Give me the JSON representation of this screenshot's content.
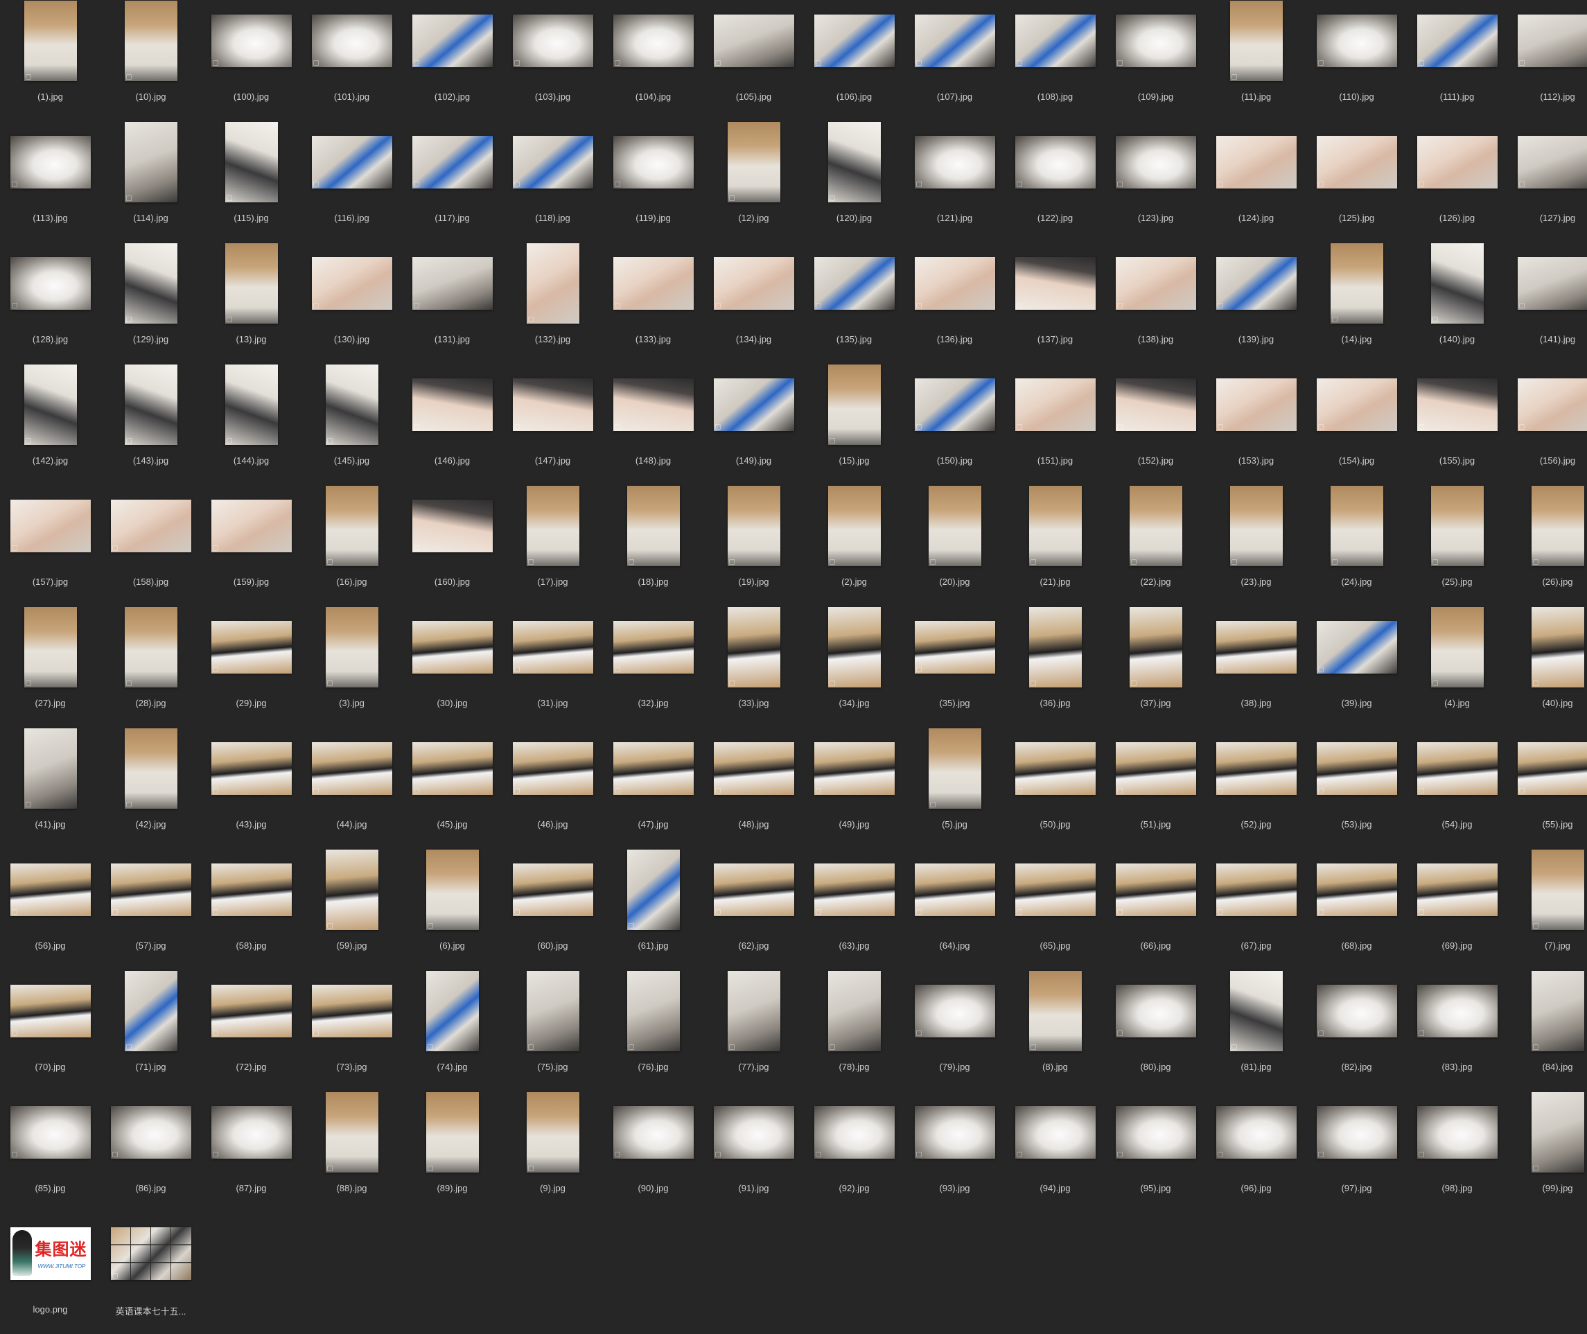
{
  "files": [
    {
      "name": "(1).jpg",
      "o": "p",
      "s": "room"
    },
    {
      "name": "(10).jpg",
      "o": "p",
      "s": "room"
    },
    {
      "name": "(100).jpg",
      "o": "l",
      "s": "sock"
    },
    {
      "name": "(101).jpg",
      "o": "l",
      "s": "sock"
    },
    {
      "name": "(102).jpg",
      "o": "l",
      "s": "blue"
    },
    {
      "name": "(103).jpg",
      "o": "l",
      "s": "sock"
    },
    {
      "name": "(104).jpg",
      "o": "l",
      "s": "sock"
    },
    {
      "name": "(105).jpg",
      "o": "l",
      "s": "sofa"
    },
    {
      "name": "(106).jpg",
      "o": "l",
      "s": "blue"
    },
    {
      "name": "(107).jpg",
      "o": "l",
      "s": "blue"
    },
    {
      "name": "(108).jpg",
      "o": "l",
      "s": "blue"
    },
    {
      "name": "(109).jpg",
      "o": "l",
      "s": "sock"
    },
    {
      "name": "(11).jpg",
      "o": "p",
      "s": "room"
    },
    {
      "name": "(110).jpg",
      "o": "l",
      "s": "sock"
    },
    {
      "name": "(111).jpg",
      "o": "l",
      "s": "blue"
    },
    {
      "name": "(112).jpg",
      "o": "l",
      "s": "sofa"
    },
    {
      "name": "(113).jpg",
      "o": "l",
      "s": "sock"
    },
    {
      "name": "(114).jpg",
      "o": "p",
      "s": "sofa"
    },
    {
      "name": "(115).jpg",
      "o": "p",
      "s": "feet"
    },
    {
      "name": "(116).jpg",
      "o": "l",
      "s": "blue"
    },
    {
      "name": "(117).jpg",
      "o": "l",
      "s": "blue"
    },
    {
      "name": "(118).jpg",
      "o": "l",
      "s": "blue"
    },
    {
      "name": "(119).jpg",
      "o": "l",
      "s": "sock"
    },
    {
      "name": "(12).jpg",
      "o": "p",
      "s": "room"
    },
    {
      "name": "(120).jpg",
      "o": "p",
      "s": "feet"
    },
    {
      "name": "(121).jpg",
      "o": "l",
      "s": "sock"
    },
    {
      "name": "(122).jpg",
      "o": "l",
      "s": "sock"
    },
    {
      "name": "(123).jpg",
      "o": "l",
      "s": "sock"
    },
    {
      "name": "(124).jpg",
      "o": "l",
      "s": "bare"
    },
    {
      "name": "(125).jpg",
      "o": "l",
      "s": "bare"
    },
    {
      "name": "(126).jpg",
      "o": "l",
      "s": "bare"
    },
    {
      "name": "(127).jpg",
      "o": "l",
      "s": "sofa"
    },
    {
      "name": "(128).jpg",
      "o": "l",
      "s": "sock"
    },
    {
      "name": "(129).jpg",
      "o": "p",
      "s": "feet"
    },
    {
      "name": "(13).jpg",
      "o": "p",
      "s": "room"
    },
    {
      "name": "(130).jpg",
      "o": "l",
      "s": "bare"
    },
    {
      "name": "(131).jpg",
      "o": "l",
      "s": "sofa"
    },
    {
      "name": "(132).jpg",
      "o": "p",
      "s": "bare"
    },
    {
      "name": "(133).jpg",
      "o": "l",
      "s": "bare"
    },
    {
      "name": "(134).jpg",
      "o": "l",
      "s": "bare"
    },
    {
      "name": "(135).jpg",
      "o": "l",
      "s": "blue"
    },
    {
      "name": "(136).jpg",
      "o": "l",
      "s": "bare"
    },
    {
      "name": "(137).jpg",
      "o": "l",
      "s": "bare2"
    },
    {
      "name": "(138).jpg",
      "o": "l",
      "s": "bare"
    },
    {
      "name": "(139).jpg",
      "o": "l",
      "s": "blue"
    },
    {
      "name": "(14).jpg",
      "o": "p",
      "s": "room"
    },
    {
      "name": "(140).jpg",
      "o": "p",
      "s": "feet"
    },
    {
      "name": "(141).jpg",
      "o": "l",
      "s": "sofa"
    },
    {
      "name": "(142).jpg",
      "o": "p",
      "s": "feet"
    },
    {
      "name": "(143).jpg",
      "o": "p",
      "s": "feet"
    },
    {
      "name": "(144).jpg",
      "o": "p",
      "s": "feet"
    },
    {
      "name": "(145).jpg",
      "o": "p",
      "s": "feet"
    },
    {
      "name": "(146).jpg",
      "o": "l",
      "s": "bare2"
    },
    {
      "name": "(147).jpg",
      "o": "l",
      "s": "bare2"
    },
    {
      "name": "(148).jpg",
      "o": "l",
      "s": "bare2"
    },
    {
      "name": "(149).jpg",
      "o": "l",
      "s": "blue"
    },
    {
      "name": "(15).jpg",
      "o": "p",
      "s": "room"
    },
    {
      "name": "(150).jpg",
      "o": "l",
      "s": "blue"
    },
    {
      "name": "(151).jpg",
      "o": "l",
      "s": "bare"
    },
    {
      "name": "(152).jpg",
      "o": "l",
      "s": "bare2"
    },
    {
      "name": "(153).jpg",
      "o": "l",
      "s": "bare"
    },
    {
      "name": "(154).jpg",
      "o": "l",
      "s": "bare"
    },
    {
      "name": "(155).jpg",
      "o": "l",
      "s": "bare2"
    },
    {
      "name": "(156).jpg",
      "o": "l",
      "s": "bare"
    },
    {
      "name": "(157).jpg",
      "o": "l",
      "s": "bare"
    },
    {
      "name": "(158).jpg",
      "o": "l",
      "s": "bare"
    },
    {
      "name": "(159).jpg",
      "o": "l",
      "s": "bare"
    },
    {
      "name": "(16).jpg",
      "o": "p",
      "s": "room"
    },
    {
      "name": "(160).jpg",
      "o": "l",
      "s": "bare2"
    },
    {
      "name": "(17).jpg",
      "o": "p",
      "s": "room"
    },
    {
      "name": "(18).jpg",
      "o": "p",
      "s": "room"
    },
    {
      "name": "(19).jpg",
      "o": "p",
      "s": "room"
    },
    {
      "name": "(2).jpg",
      "o": "p",
      "s": "room"
    },
    {
      "name": "(20).jpg",
      "o": "p",
      "s": "room"
    },
    {
      "name": "(21).jpg",
      "o": "p",
      "s": "room"
    },
    {
      "name": "(22).jpg",
      "o": "p",
      "s": "room"
    },
    {
      "name": "(23).jpg",
      "o": "p",
      "s": "room"
    },
    {
      "name": "(24).jpg",
      "o": "p",
      "s": "room"
    },
    {
      "name": "(25).jpg",
      "o": "p",
      "s": "room"
    },
    {
      "name": "(26).jpg",
      "o": "p",
      "s": "room"
    },
    {
      "name": "(27).jpg",
      "o": "p",
      "s": "room"
    },
    {
      "name": "(28).jpg",
      "o": "p",
      "s": "room"
    },
    {
      "name": "(29).jpg",
      "o": "l",
      "s": "shoe"
    },
    {
      "name": "(3).jpg",
      "o": "p",
      "s": "room"
    },
    {
      "name": "(30).jpg",
      "o": "l",
      "s": "shoe"
    },
    {
      "name": "(31).jpg",
      "o": "l",
      "s": "shoe"
    },
    {
      "name": "(32).jpg",
      "o": "l",
      "s": "shoe"
    },
    {
      "name": "(33).jpg",
      "o": "p",
      "s": "shoe"
    },
    {
      "name": "(34).jpg",
      "o": "p",
      "s": "shoe"
    },
    {
      "name": "(35).jpg",
      "o": "l",
      "s": "shoe"
    },
    {
      "name": "(36).jpg",
      "o": "p",
      "s": "shoe"
    },
    {
      "name": "(37).jpg",
      "o": "p",
      "s": "shoe"
    },
    {
      "name": "(38).jpg",
      "o": "l",
      "s": "shoe"
    },
    {
      "name": "(39).jpg",
      "o": "l",
      "s": "blue"
    },
    {
      "name": "(4).jpg",
      "o": "p",
      "s": "room"
    },
    {
      "name": "(40).jpg",
      "o": "p",
      "s": "shoe"
    },
    {
      "name": "(41).jpg",
      "o": "p",
      "s": "sofa"
    },
    {
      "name": "(42).jpg",
      "o": "p",
      "s": "room"
    },
    {
      "name": "(43).jpg",
      "o": "l",
      "s": "shoe"
    },
    {
      "name": "(44).jpg",
      "o": "l",
      "s": "shoe"
    },
    {
      "name": "(45).jpg",
      "o": "l",
      "s": "shoe"
    },
    {
      "name": "(46).jpg",
      "o": "l",
      "s": "shoe"
    },
    {
      "name": "(47).jpg",
      "o": "l",
      "s": "shoe"
    },
    {
      "name": "(48).jpg",
      "o": "l",
      "s": "shoe"
    },
    {
      "name": "(49).jpg",
      "o": "l",
      "s": "shoe"
    },
    {
      "name": "(5).jpg",
      "o": "p",
      "s": "room"
    },
    {
      "name": "(50).jpg",
      "o": "l",
      "s": "shoe"
    },
    {
      "name": "(51).jpg",
      "o": "l",
      "s": "shoe"
    },
    {
      "name": "(52).jpg",
      "o": "l",
      "s": "shoe"
    },
    {
      "name": "(53).jpg",
      "o": "l",
      "s": "shoe"
    },
    {
      "name": "(54).jpg",
      "o": "l",
      "s": "shoe"
    },
    {
      "name": "(55).jpg",
      "o": "l",
      "s": "shoe"
    },
    {
      "name": "(56).jpg",
      "o": "l",
      "s": "shoe"
    },
    {
      "name": "(57).jpg",
      "o": "l",
      "s": "shoe"
    },
    {
      "name": "(58).jpg",
      "o": "l",
      "s": "shoe"
    },
    {
      "name": "(59).jpg",
      "o": "p",
      "s": "shoe"
    },
    {
      "name": "(6).jpg",
      "o": "p",
      "s": "room"
    },
    {
      "name": "(60).jpg",
      "o": "l",
      "s": "shoe"
    },
    {
      "name": "(61).jpg",
      "o": "p",
      "s": "blue"
    },
    {
      "name": "(62).jpg",
      "o": "l",
      "s": "shoe"
    },
    {
      "name": "(63).jpg",
      "o": "l",
      "s": "shoe"
    },
    {
      "name": "(64).jpg",
      "o": "l",
      "s": "shoe"
    },
    {
      "name": "(65).jpg",
      "o": "l",
      "s": "shoe"
    },
    {
      "name": "(66).jpg",
      "o": "l",
      "s": "shoe"
    },
    {
      "name": "(67).jpg",
      "o": "l",
      "s": "shoe"
    },
    {
      "name": "(68).jpg",
      "o": "l",
      "s": "shoe"
    },
    {
      "name": "(69).jpg",
      "o": "l",
      "s": "shoe"
    },
    {
      "name": "(7).jpg",
      "o": "p",
      "s": "room"
    },
    {
      "name": "(70).jpg",
      "o": "l",
      "s": "shoe"
    },
    {
      "name": "(71).jpg",
      "o": "p",
      "s": "blue"
    },
    {
      "name": "(72).jpg",
      "o": "l",
      "s": "shoe"
    },
    {
      "name": "(73).jpg",
      "o": "l",
      "s": "shoe"
    },
    {
      "name": "(74).jpg",
      "o": "p",
      "s": "blue"
    },
    {
      "name": "(75).jpg",
      "o": "p",
      "s": "sofa"
    },
    {
      "name": "(76).jpg",
      "o": "p",
      "s": "sofa"
    },
    {
      "name": "(77).jpg",
      "o": "p",
      "s": "sofa"
    },
    {
      "name": "(78).jpg",
      "o": "p",
      "s": "sofa"
    },
    {
      "name": "(79).jpg",
      "o": "l",
      "s": "sock"
    },
    {
      "name": "(8).jpg",
      "o": "p",
      "s": "room"
    },
    {
      "name": "(80).jpg",
      "o": "l",
      "s": "sock"
    },
    {
      "name": "(81).jpg",
      "o": "p",
      "s": "feet"
    },
    {
      "name": "(82).jpg",
      "o": "l",
      "s": "sock"
    },
    {
      "name": "(83).jpg",
      "o": "l",
      "s": "sock"
    },
    {
      "name": "(84).jpg",
      "o": "p",
      "s": "sofa"
    },
    {
      "name": "(85).jpg",
      "o": "l",
      "s": "sock"
    },
    {
      "name": "(86).jpg",
      "o": "l",
      "s": "sock"
    },
    {
      "name": "(87).jpg",
      "o": "l",
      "s": "sock"
    },
    {
      "name": "(88).jpg",
      "o": "p",
      "s": "room"
    },
    {
      "name": "(89).jpg",
      "o": "p",
      "s": "room"
    },
    {
      "name": "(9).jpg",
      "o": "p",
      "s": "room"
    },
    {
      "name": "(90).jpg",
      "o": "l",
      "s": "sock"
    },
    {
      "name": "(91).jpg",
      "o": "l",
      "s": "sock"
    },
    {
      "name": "(92).jpg",
      "o": "l",
      "s": "sock"
    },
    {
      "name": "(93).jpg",
      "o": "l",
      "s": "sock"
    },
    {
      "name": "(94).jpg",
      "o": "l",
      "s": "sock"
    },
    {
      "name": "(95).jpg",
      "o": "l",
      "s": "sock"
    },
    {
      "name": "(96).jpg",
      "o": "l",
      "s": "sock"
    },
    {
      "name": "(97).jpg",
      "o": "l",
      "s": "sock"
    },
    {
      "name": "(98).jpg",
      "o": "l",
      "s": "sock"
    },
    {
      "name": "(99).jpg",
      "o": "p",
      "s": "sofa"
    },
    {
      "name": "logo.png",
      "o": "l",
      "s": "logo",
      "logo_text": "集图迷",
      "logo_url": "WWW.JITUMI.TOP"
    },
    {
      "name": "英语课本七十五...",
      "o": "l",
      "s": "mosaic"
    }
  ],
  "colors": {
    "background": "#262626",
    "caption": "#cfcfcf",
    "logo_red": "#e02424",
    "logo_blue": "#2d6fb6"
  }
}
